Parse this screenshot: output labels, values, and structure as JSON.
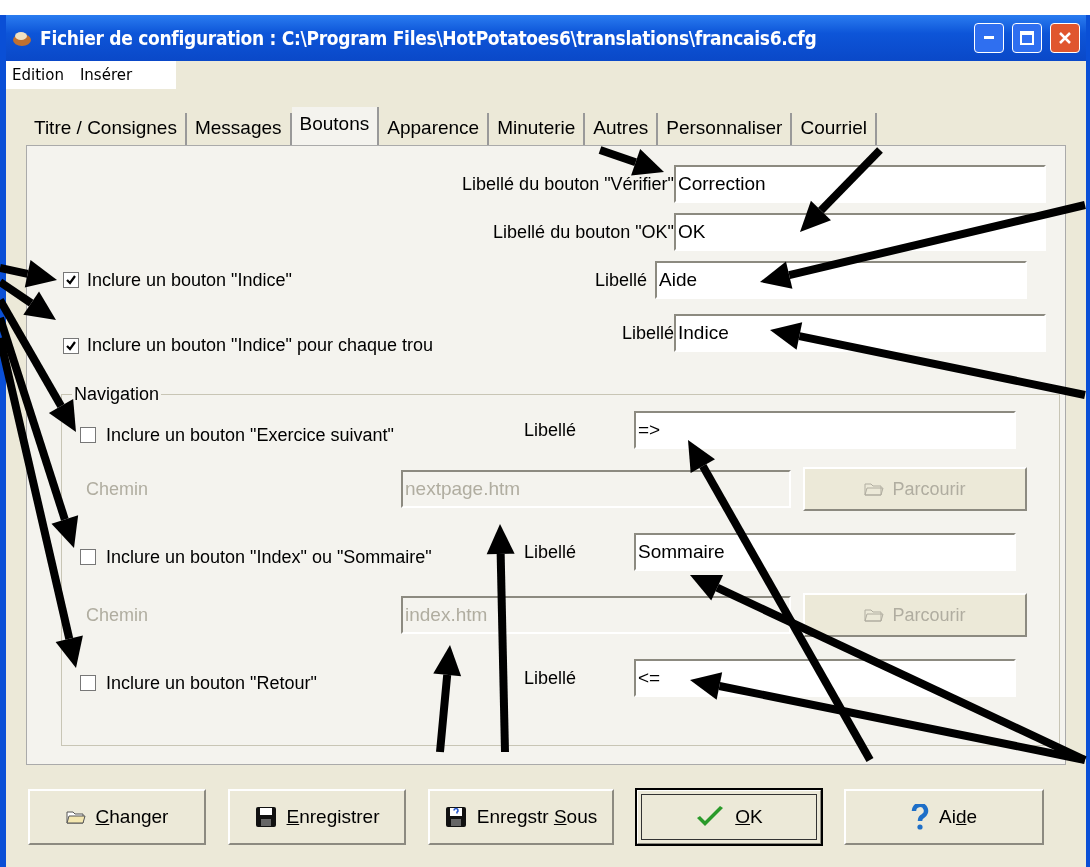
{
  "window": {
    "title": "Fichier de configuration : C:\\Program Files\\HotPotatoes6\\translations\\francais6.cfg"
  },
  "menu": [
    "Edition",
    "Insérer"
  ],
  "tabs": [
    {
      "label": "Titre / Consignes",
      "selected": false
    },
    {
      "label": "Messages",
      "selected": false
    },
    {
      "label": "Boutons",
      "selected": true
    },
    {
      "label": "Apparence",
      "selected": false
    },
    {
      "label": "Minuterie",
      "selected": false
    },
    {
      "label": "Autres",
      "selected": false
    },
    {
      "label": "Personnaliser",
      "selected": false
    },
    {
      "label": "Courriel",
      "selected": false
    }
  ],
  "fields": [
    {
      "label": "Libellé du bouton \"Vérifier\"",
      "value": "Correction"
    },
    {
      "label": "Libellé du bouton \"OK\"",
      "value": "OK"
    }
  ],
  "hint_options": [
    {
      "label": "Inclure un bouton \"Indice\"",
      "checked": true,
      "field_label": "Libellé",
      "value": "Aide"
    },
    {
      "label": "Inclure un bouton \"Indice\" pour chaque trou",
      "checked": true,
      "field_label": "Libellé",
      "value": "Indice"
    }
  ],
  "navigation": {
    "title": "Navigation",
    "items": [
      {
        "label": "Inclure un bouton \"Exercice suivant\"",
        "checked": false,
        "field_label": "Libellé",
        "value": "=>",
        "path": {
          "label": "Chemin",
          "value": "nextpage.htm",
          "browse": "Parcourir",
          "disabled": true
        }
      },
      {
        "label": "Inclure un bouton \"Index\" ou \"Sommaire\"",
        "checked": false,
        "field_label": "Libellé",
        "value": "Sommaire",
        "path": {
          "label": "Chemin",
          "value": "index.htm",
          "browse": "Parcourir",
          "disabled": true
        }
      },
      {
        "label": "Inclure un bouton \"Retour\"",
        "checked": false,
        "field_label": "Libellé",
        "value": "<="
      }
    ]
  },
  "buttons": [
    {
      "access_key": "C",
      "text_after": "hanger",
      "default": false
    },
    {
      "access_key": "E",
      "text_after": "nregistrer",
      "default": false
    },
    {
      "text_before": "Enregstr ",
      "access_key": "S",
      "text_after": "ous",
      "default": false
    },
    {
      "access_key": "O",
      "text_after": "K",
      "default": true
    },
    {
      "text_before": "Ai",
      "access_key": "d",
      "text_after": "e",
      "default": false
    }
  ]
}
